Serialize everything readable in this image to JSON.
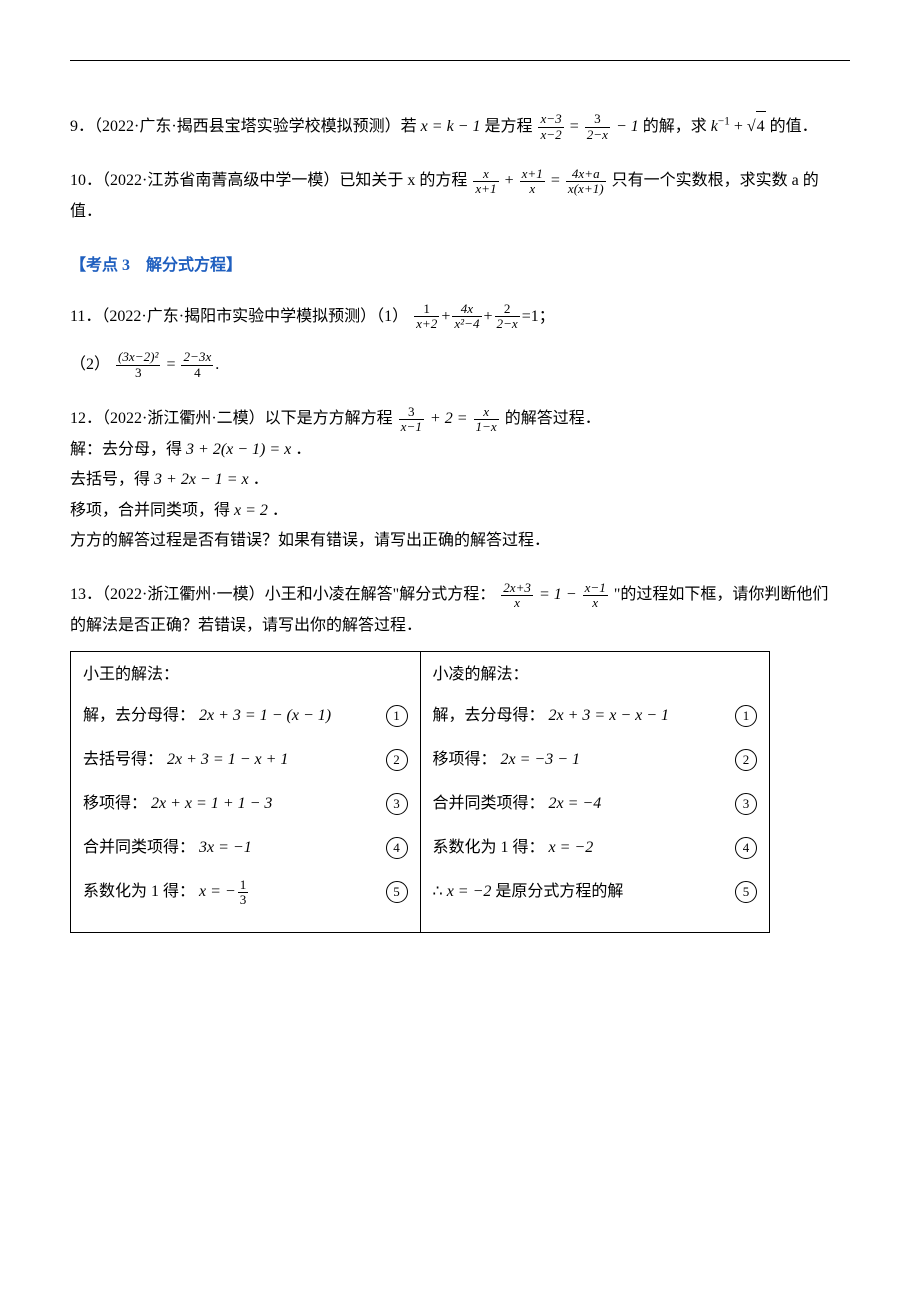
{
  "p9": {
    "prefix": "9．（2022·广东·揭西县宝塔实验学校模拟预测）若",
    "expr1a": "x = k − 1",
    "mid1": "是方程",
    "frac1num": "x−3",
    "frac1den": "x−2",
    "eq1": " = ",
    "frac2num": "3",
    "frac2den": "2−x",
    "tail1a": " − 1",
    "mid2": "的解，求",
    "kexp": "k",
    "ksup": "−1",
    "plus": " + ",
    "sqrt4": "4",
    "tail": "的值．"
  },
  "p10": {
    "prefix": "10．（2022·江苏省南菁高级中学一模）已知关于 x 的方程",
    "f1n": "x",
    "f1d": "x+1",
    "plus": " + ",
    "f2n": "x+1",
    "f2d": "x",
    "eq": " = ",
    "f3n": "4x+a",
    "f3d": "x(x+1)",
    "tail": "只有一个实数根，求实数 a 的值．"
  },
  "section3": "【考点 3　解分式方程】",
  "p11": {
    "prefix": "11．（2022·广东·揭阳市实验中学模拟预测）（1）",
    "f1n": "1",
    "f1d": "x+2",
    "p1": "+",
    "f2n": "4x",
    "f2d": "x²−4",
    "p2": "+",
    "f3n": "2",
    "f3d": "2−x",
    "eq1": "=1；",
    "part2pre": "（2）",
    "g1n": "(3x−2)²",
    "g1d": "3",
    "eq2": " = ",
    "g2n": "2−3x",
    "g2d": "4",
    "period": "."
  },
  "p12": {
    "prefix": "12．（2022·浙江衢州·二模）以下是方方解方程",
    "f1n": "3",
    "f1d": "x−1",
    "plus": " + 2 = ",
    "f2n": "x",
    "f2d": "1−x",
    "after": "的解答过程．",
    "line1a": "解：去分母，得",
    "line1b": "3 + 2(x − 1) =  x",
    "line1c": "．",
    "line2a": "去括号，得",
    "line2b": "3 + 2x − 1 = x",
    "line2c": "．",
    "line3a": "移项，合并同类项，得",
    "line3b": "x = 2",
    "line3c": "．",
    "line4": "方方的解答过程是否有错误？如果有错误，请写出正确的解答过程．"
  },
  "p13": {
    "prefix": "13．（2022·浙江衢州·一模）小王和小凌在解答\"解分式方程：",
    "f1n": "2x+3",
    "f1d": "x",
    "eq": " = 1 − ",
    "f2n": "x−1",
    "f2d": "x",
    "after": "\"的过程如下框，请你判断他们",
    "line2": "的解法是否正确？若错误，请写出你的解答过程．",
    "left": {
      "head": "小王的解法：",
      "s1a": "解，去分母得：",
      "s1b": "2x + 3 = 1 − (x − 1)",
      "s2a": "去括号得：",
      "s2b": "2x + 3 = 1 − x + 1",
      "s3a": "移项得：",
      "s3b": "2x + x = 1 + 1 − 3",
      "s4a": "合并同类项得：",
      "s4b": "3x = −1",
      "s5a": "系数化为 1 得：",
      "s5b_num": "1",
      "s5b_den": "3",
      "s5b_pre": "x = −"
    },
    "right": {
      "head": "小凌的解法：",
      "s1a": "解，去分母得：",
      "s1b": "2x + 3 = x − x − 1",
      "s2a": "移项得：",
      "s2b": "2x = −3 − 1",
      "s3a": "合并同类项得：",
      "s3b": "2x = −4",
      "s4a": "系数化为 1 得：",
      "s4b": "x = −2",
      "s5pre": "∴ ",
      "s5mid": "x = −2",
      "s5after": "是原分式方程的解"
    },
    "nums": {
      "n1": "1",
      "n2": "2",
      "n3": "3",
      "n4": "4",
      "n5": "5"
    }
  }
}
